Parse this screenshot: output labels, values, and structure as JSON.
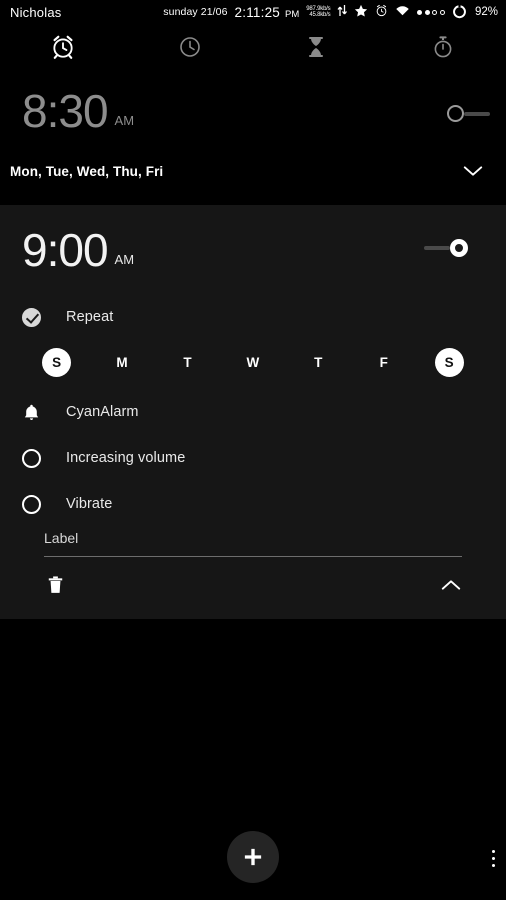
{
  "statusbar": {
    "user": "Nicholas",
    "date": "sunday 21/06",
    "time": "2:11:25",
    "ampm": "PM",
    "net_down": "987.9kb/s",
    "net_up": "45.8kb/s",
    "icons": [
      "network-speed-icon",
      "star-icon",
      "alarm-set-icon",
      "wifi-icon",
      "signal-dots-icon",
      "battery-icon"
    ],
    "battery": "92%"
  },
  "tabs": [
    {
      "name": "tab-alarm",
      "icon": "alarm-clock-icon",
      "active": true
    },
    {
      "name": "tab-clock",
      "icon": "clock-icon",
      "active": false
    },
    {
      "name": "tab-timer",
      "icon": "hourglass-icon",
      "active": false
    },
    {
      "name": "tab-stopwatch",
      "icon": "stopwatch-icon",
      "active": false
    }
  ],
  "alarms": [
    {
      "time": "8:30",
      "ampm": "AM",
      "enabled": false,
      "days_summary": "Mon, Tue, Wed, Thu, Fri",
      "expanded": false,
      "expand_icon": "chevron-down-icon"
    },
    {
      "time": "9:00",
      "ampm": "AM",
      "enabled": true,
      "expanded": true,
      "collapse_icon": "chevron-up-icon",
      "repeat": {
        "label": "Repeat",
        "checked": true,
        "icon": "check-circle-icon"
      },
      "days": [
        {
          "letter": "S",
          "selected": true
        },
        {
          "letter": "M",
          "selected": false
        },
        {
          "letter": "T",
          "selected": false
        },
        {
          "letter": "W",
          "selected": false
        },
        {
          "letter": "T",
          "selected": false
        },
        {
          "letter": "F",
          "selected": false
        },
        {
          "letter": "S",
          "selected": true
        }
      ],
      "ringtone": {
        "label": "CyanAlarm",
        "icon": "bell-icon"
      },
      "increasing_volume": {
        "label": "Increasing volume",
        "checked": false,
        "icon": "circle-unchecked-icon"
      },
      "vibrate": {
        "label": "Vibrate",
        "checked": false,
        "icon": "circle-unchecked-icon"
      },
      "label_field": {
        "placeholder": "Label",
        "value": ""
      },
      "delete_icon": "trash-icon"
    }
  ],
  "bottom": {
    "fab": {
      "label": "+",
      "icon": "plus-icon"
    },
    "overflow": {
      "icon": "more-vertical-icon"
    }
  },
  "colors": {
    "background": "#000000",
    "card": "#161616",
    "accent": "#ffffff",
    "muted": "#8d8d8d",
    "fab": "#252525"
  }
}
